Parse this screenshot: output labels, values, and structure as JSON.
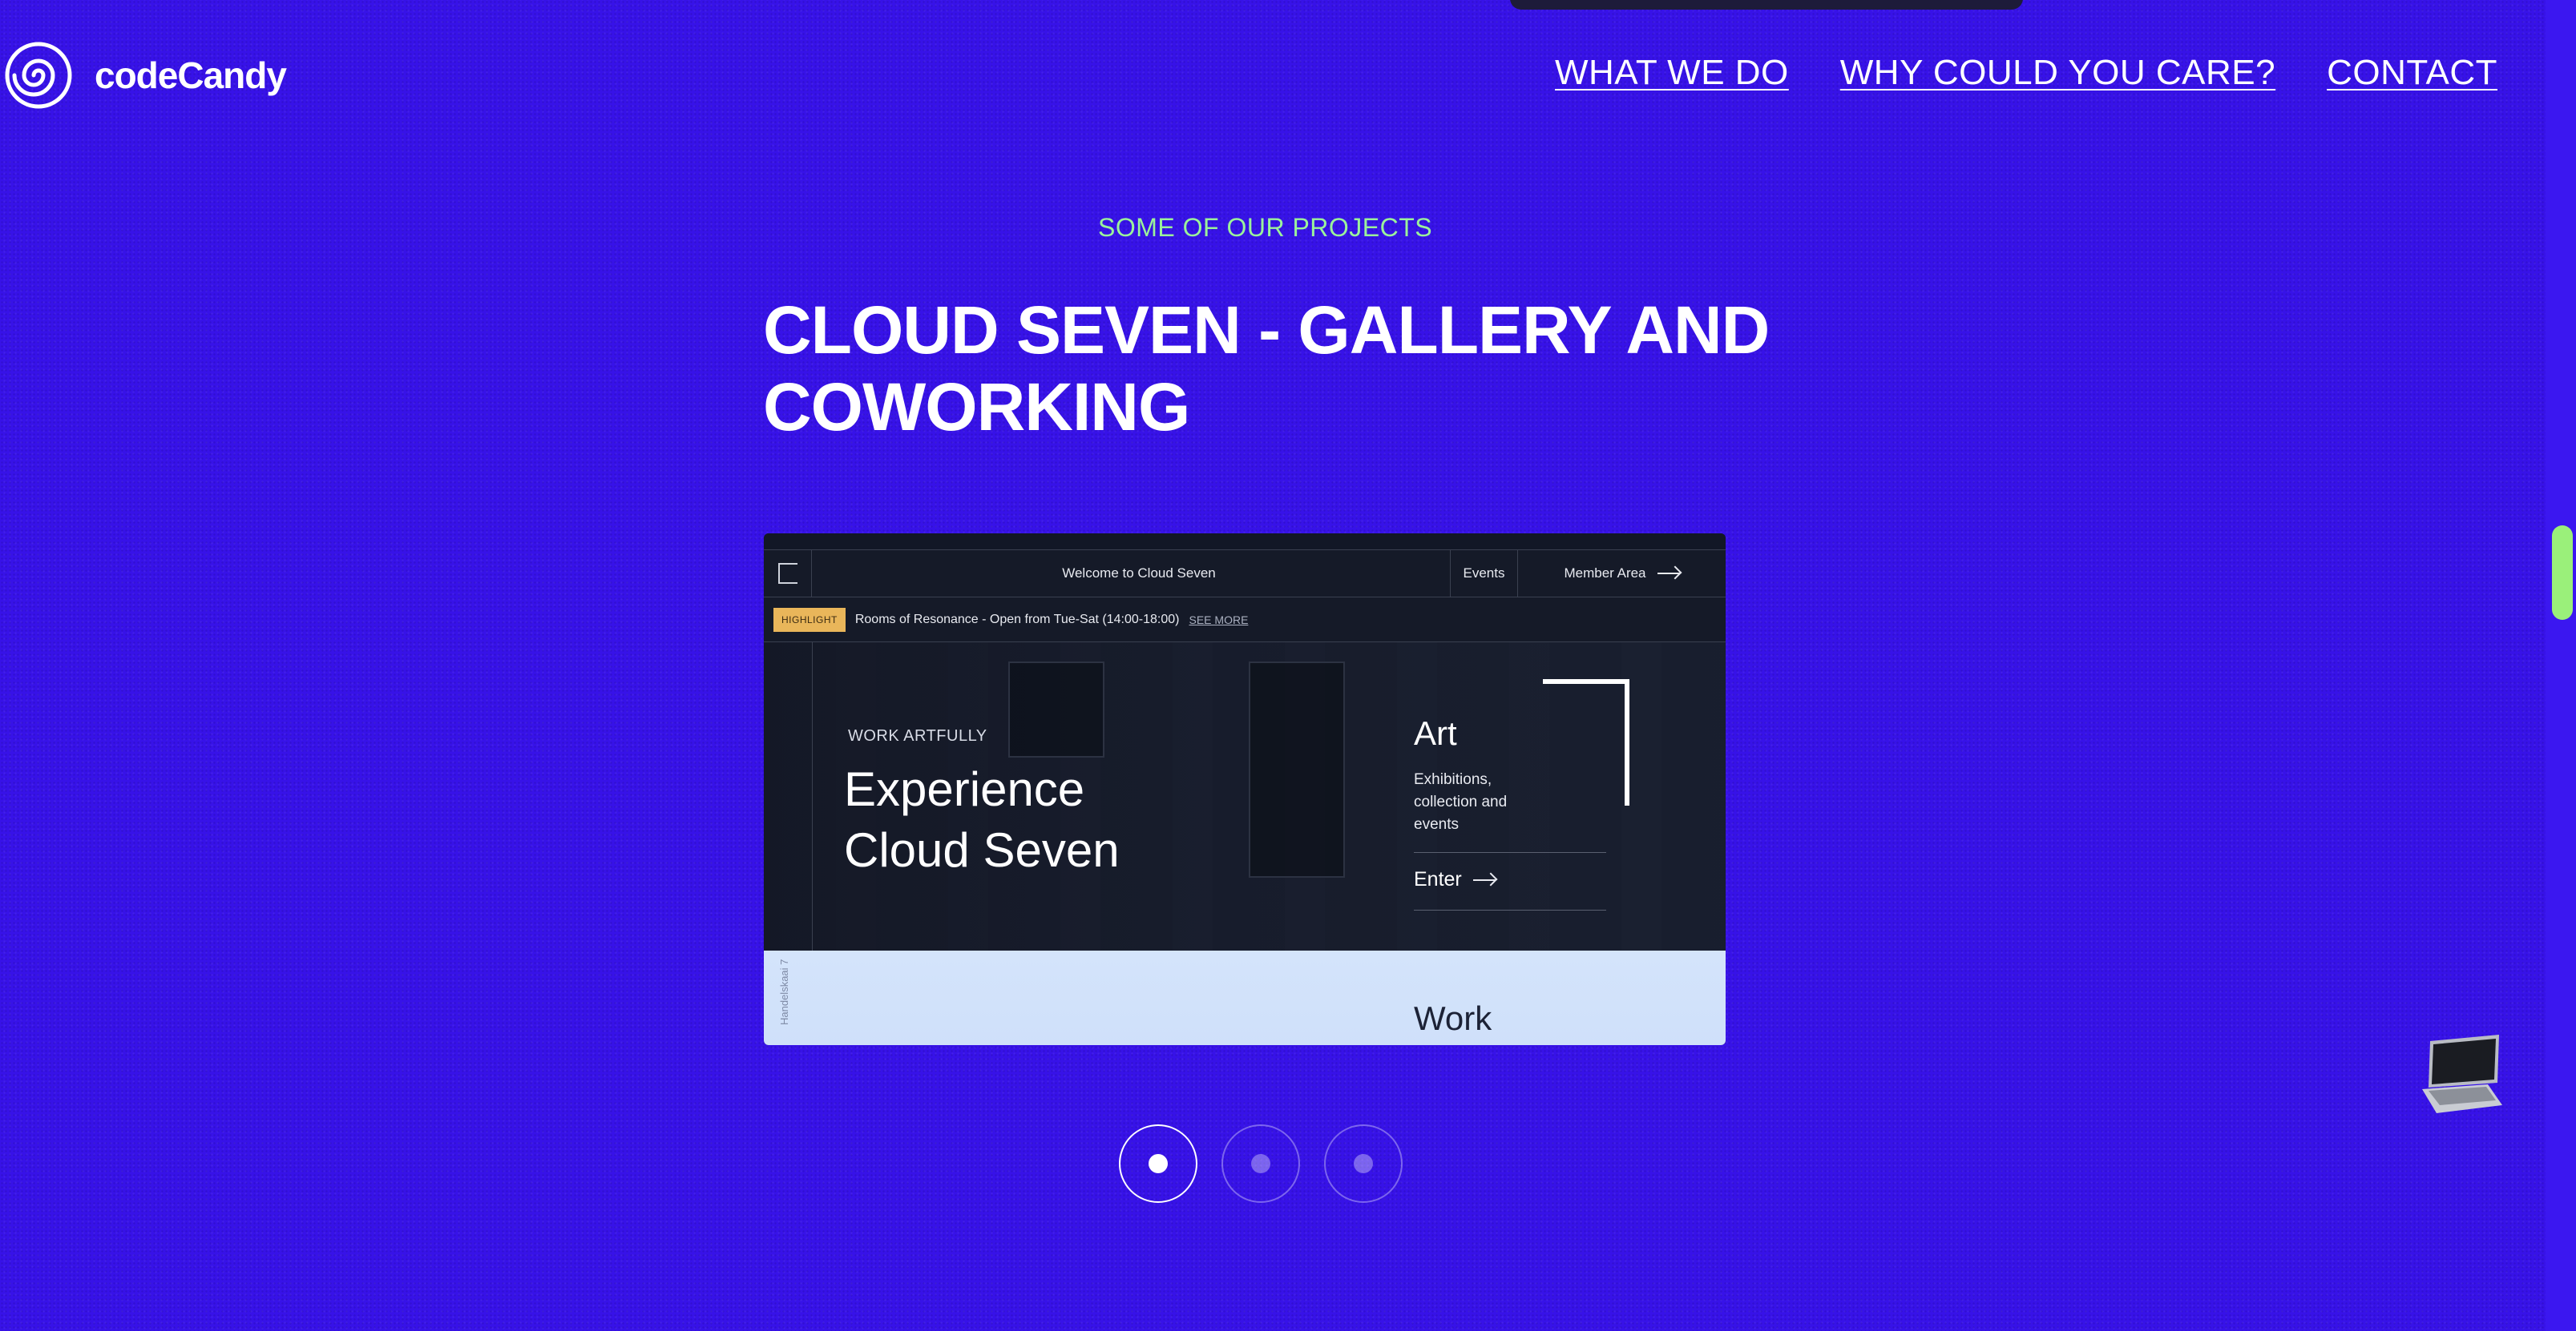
{
  "header": {
    "brand": "codeCandy",
    "nav": [
      "WHAT WE DO",
      "WHY COULD YOU CARE?",
      "CONTACT"
    ]
  },
  "section": {
    "eyebrow": "SOME OF OUR PROJECTS",
    "title": "CLOUD SEVEN - GALLERY AND COWORKING"
  },
  "preview": {
    "welcome": "Welcome to Cloud Seven",
    "events": "Events",
    "member": "Member Area",
    "badge": "HIGHLIGHT",
    "highlight_text": "Rooms of Resonance - Open from Tue-Sat (14:00-18:00)",
    "see_more": "SEE MORE",
    "eyebrow": "WORK ARTFULLY",
    "title": "Experience\nCloud Seven",
    "art_title": "Art",
    "art_desc": "Exhibitions, collection and events",
    "enter": "Enter",
    "side_text": "Handelskaai 7",
    "work_title": "Work"
  },
  "carousel": {
    "count": 3,
    "active_index": 0
  },
  "colors": {
    "background": "#3712e8",
    "accent_green": "#9bf29b",
    "scrollbar": "#9af07a",
    "highlight_badge": "#e9b65a"
  }
}
